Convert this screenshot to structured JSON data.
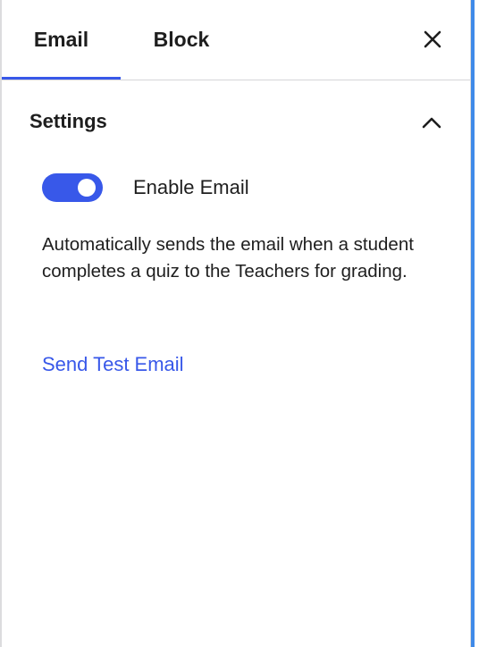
{
  "tabs": [
    {
      "label": "Email",
      "active": true
    },
    {
      "label": "Block",
      "active": false
    }
  ],
  "header": {
    "close_icon": "close-icon"
  },
  "settings": {
    "title": "Settings",
    "collapse_icon": "chevron-up-icon",
    "expanded": true,
    "enable_email": {
      "label": "Enable Email",
      "checked": true
    },
    "help_text": "Automatically sends the email when a student completes a quiz to the Teachers for grading.",
    "test_link": "Send Test Email"
  },
  "colors": {
    "accent": "#3858e9",
    "text": "#1e1e1e",
    "divider": "#d5d5d8",
    "focus_edge": "#3f8ae8"
  }
}
